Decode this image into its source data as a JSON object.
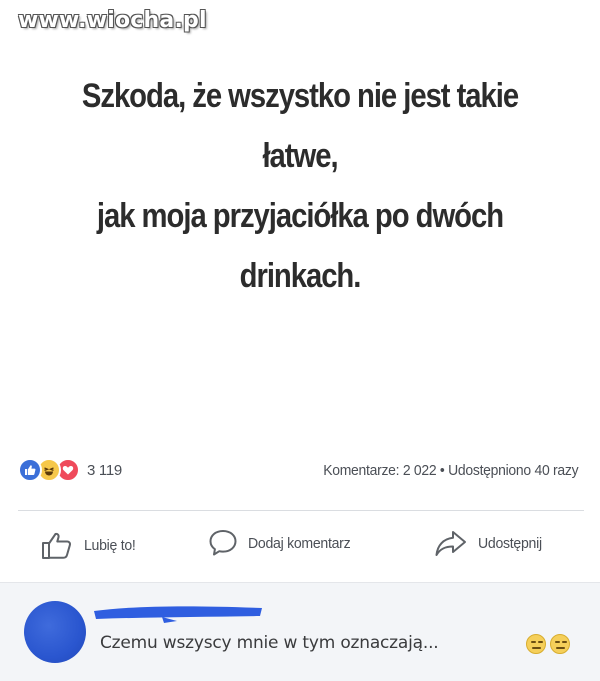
{
  "watermark": "www.wiocha.pl",
  "post": {
    "lines": [
      "Szkoda, że wszystko nie jest takie",
      "łatwe,",
      "jak moja przyjaciółka po dwóch",
      "drinkach."
    ]
  },
  "stats": {
    "reaction_count": "3 119",
    "comments_shares": "Komentarze: 2 022 • Udostępniono 40 razy",
    "reaction_icons": [
      "like-icon",
      "haha-icon",
      "love-icon"
    ]
  },
  "actions": {
    "like_label": "Lubię to!",
    "comment_label": "Dodaj komentarz",
    "share_label": "Udostępnij"
  },
  "comment": {
    "text": "Czemu wszyscy mnie w tym oznaczają...",
    "emojis": [
      "smile-icon",
      "smile-icon"
    ]
  },
  "colors": {
    "like_blue": "#3b6fd8",
    "love_red": "#ef4a5b",
    "haha_yellow": "#f6c84a",
    "scribble_blue": "#2f5ee0"
  }
}
